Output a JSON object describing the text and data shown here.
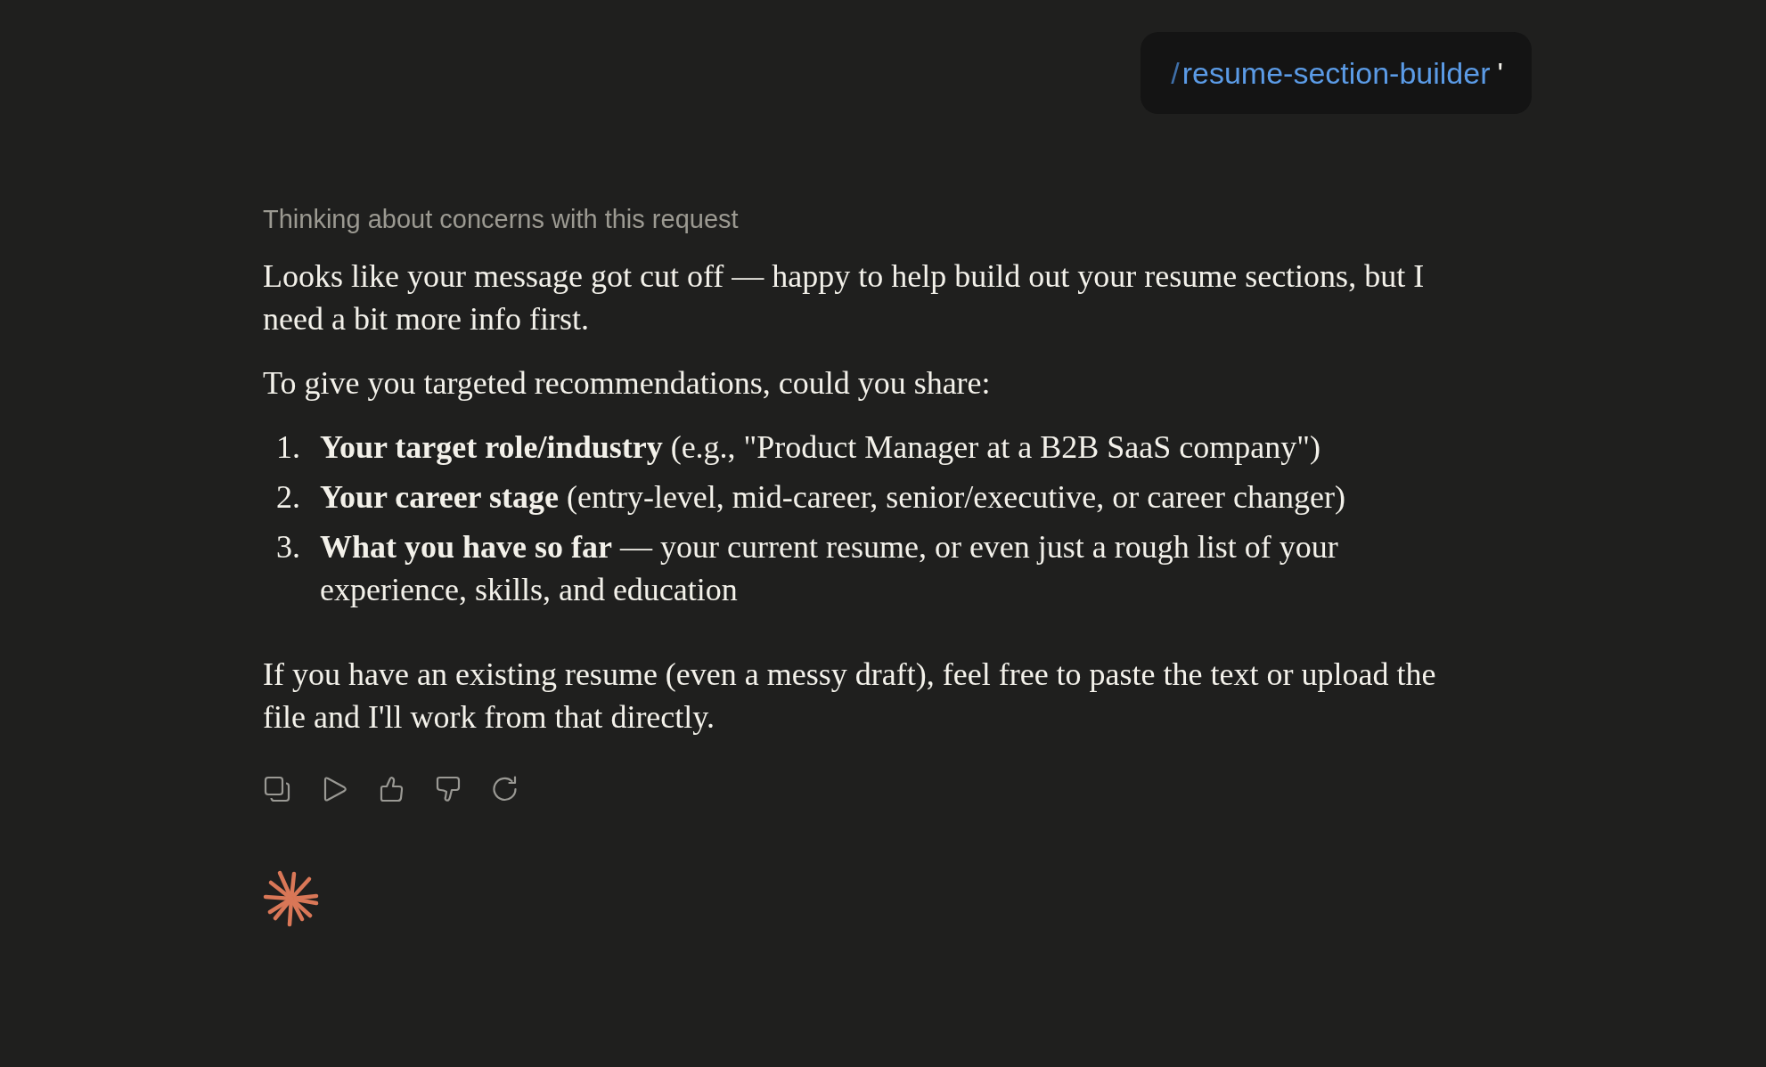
{
  "user_message": {
    "slash": "/",
    "command": "resume-section-builder",
    "text": "'"
  },
  "response": {
    "thinking_label": "Thinking about concerns with this request",
    "blocks": [
      {
        "kind": "paragraph",
        "text": "Looks like your message got cut off — happy to help build out your resume sections, but I need a bit more info first."
      },
      {
        "kind": "paragraph",
        "text": "To give you targeted recommendations, could you share:"
      },
      {
        "kind": "ordered_list",
        "items": [
          {
            "marker": "1.",
            "text": "**Your target role/industry** (e.g., \"Product Manager at a B2B SaaS company\")"
          },
          {
            "marker": "2.",
            "text": "**Your career stage** (entry-level, mid-career, senior/executive, or career changer)"
          },
          {
            "marker": "3.",
            "text": "**What you have so far** — your current resume, or even just a rough list of your experience, skills, and education"
          }
        ]
      },
      {
        "kind": "paragraph",
        "text": "If you have an existing resume (even a messy draft), feel free to paste the text or upload the file and I'll work from that directly."
      }
    ]
  }
}
